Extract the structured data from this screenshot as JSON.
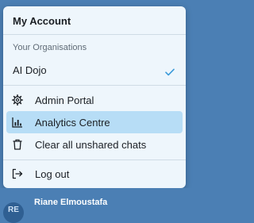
{
  "menu": {
    "title": "My Account",
    "section_label": "Your Organisations",
    "organisation": {
      "name": "AI Dojo",
      "selected": true,
      "icon": "check-icon"
    },
    "items": [
      {
        "label": "Admin Portal",
        "icon": "gear-icon"
      },
      {
        "label": "Analytics Centre",
        "icon": "chart-icon",
        "active": true
      },
      {
        "label": "Clear all unshared chats",
        "icon": "trash-icon"
      }
    ],
    "logout": {
      "label": "Log out",
      "icon": "logout-icon"
    }
  },
  "user": {
    "name": "Riane Elmoustafa",
    "initials": "RE"
  },
  "colors": {
    "menu_background": "#eef6fc",
    "active_row": "#b7ddf6",
    "check_accent": "#3a9ad9",
    "page_background": "#4b7fb4"
  }
}
